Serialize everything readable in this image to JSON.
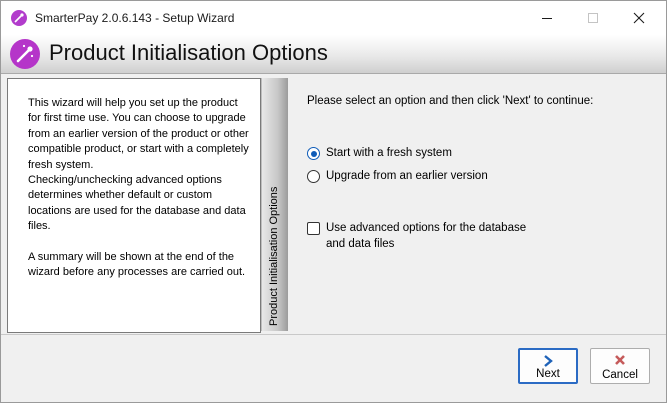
{
  "window": {
    "title": "SmarterPay 2.0.6.143 - Setup Wizard"
  },
  "header": {
    "title": "Product Initialisation Options"
  },
  "left_panel": {
    "description": "This wizard will help you set up the product for first time use. You can choose to upgrade from an earlier version of the product or other compatible product, or start with a completely fresh system.\nChecking/unchecking advanced options determines whether default or custom locations are used for the database and data files.\n\nA summary will be shown at the end of the wizard before any processes are carried out."
  },
  "side_tab": {
    "label": "Product Initialisation Options"
  },
  "main": {
    "prompt": "Please select an option and then click 'Next' to continue:",
    "options": [
      {
        "label": "Start with a fresh system",
        "selected": true
      },
      {
        "label": "Upgrade from an earlier version",
        "selected": false
      }
    ],
    "advanced": {
      "label": "Use advanced options for the database\nand data files",
      "checked": false
    }
  },
  "buttons": {
    "next_label": "Next",
    "cancel_label": "Cancel"
  },
  "colors": {
    "accent": "#0f5cb8",
    "brand_icon": "#b535c9",
    "next_arrow": "#1e62b8",
    "cancel_x": "#c55a5a"
  },
  "icons": {
    "app": "magic-wand-icon",
    "header": "magic-wand-icon",
    "next": "chevron-right-icon",
    "cancel": "close-icon"
  }
}
